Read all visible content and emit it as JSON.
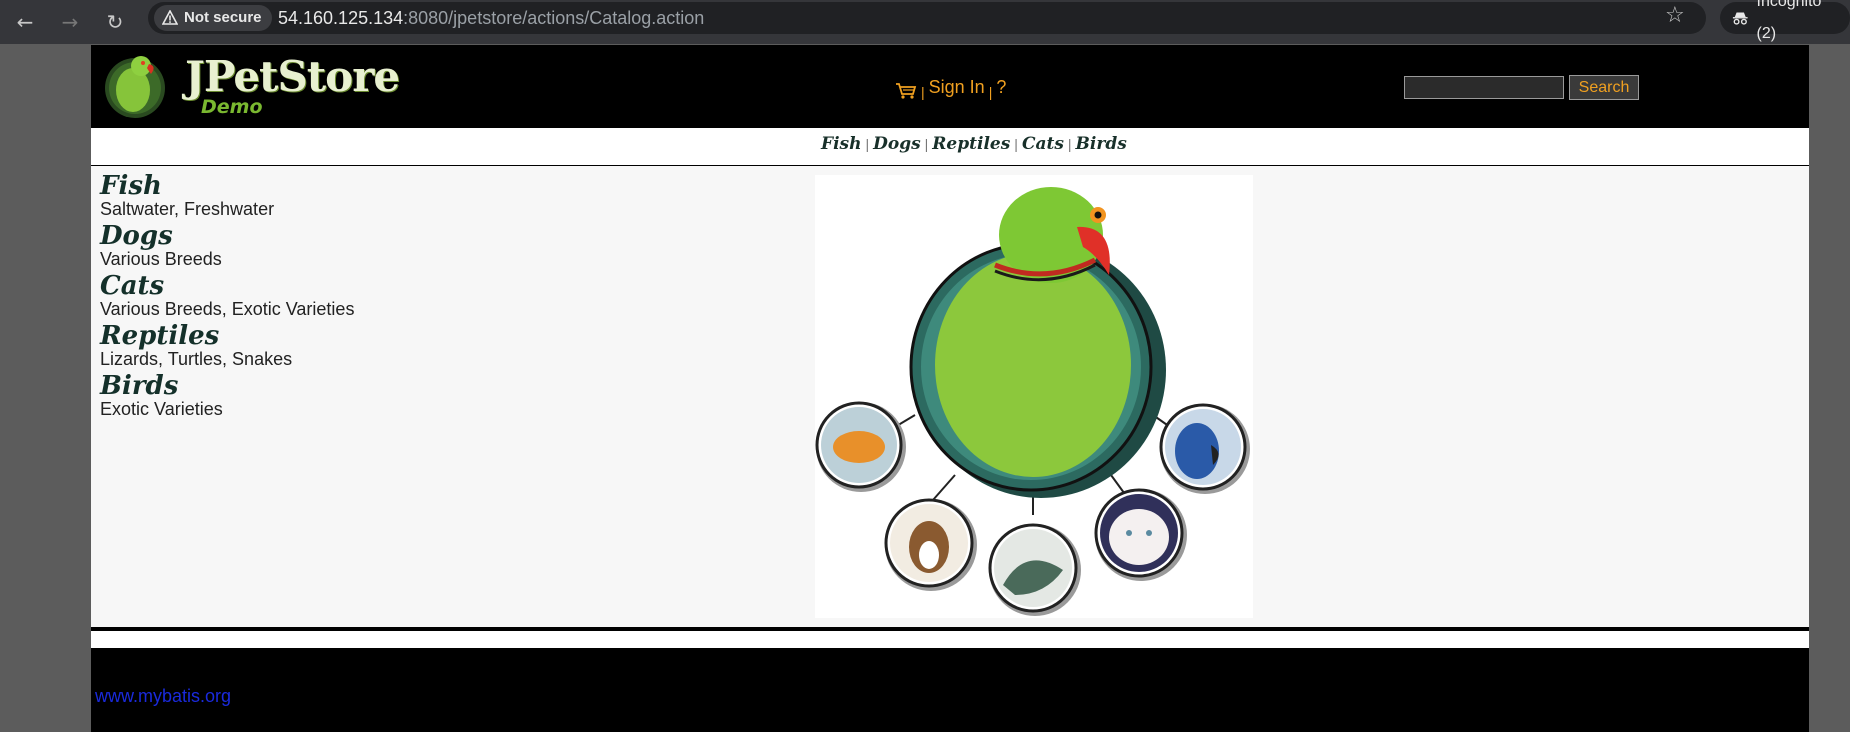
{
  "browser": {
    "security_label": "Not secure",
    "url_host": "54.160.125.134",
    "url_rest": ":8080/jpetstore/actions/Catalog.action",
    "incognito_label": "Incognito (2)"
  },
  "header": {
    "logo_title": "JPetStore",
    "logo_subtitle": "Demo",
    "sign_in": "Sign In",
    "help": "?",
    "menu_sep": "|",
    "search_button": "Search",
    "search_value": ""
  },
  "quicklinks": [
    "Fish",
    "Dogs",
    "Reptiles",
    "Cats",
    "Birds"
  ],
  "quicklink_sep": "|",
  "categories": [
    {
      "name": "Fish",
      "desc": "Saltwater, Freshwater"
    },
    {
      "name": "Dogs",
      "desc": "Various Breeds"
    },
    {
      "name": "Cats",
      "desc": "Various Breeds, Exotic Varieties"
    },
    {
      "name": "Reptiles",
      "desc": "Lizards, Turtles, Snakes"
    },
    {
      "name": "Birds",
      "desc": "Exotic Varieties"
    }
  ],
  "footer": {
    "link": "www.mybatis.org"
  },
  "colors": {
    "accent": "#f0a020",
    "link_blue": "#1a2adc",
    "category_text": "#14302a"
  }
}
